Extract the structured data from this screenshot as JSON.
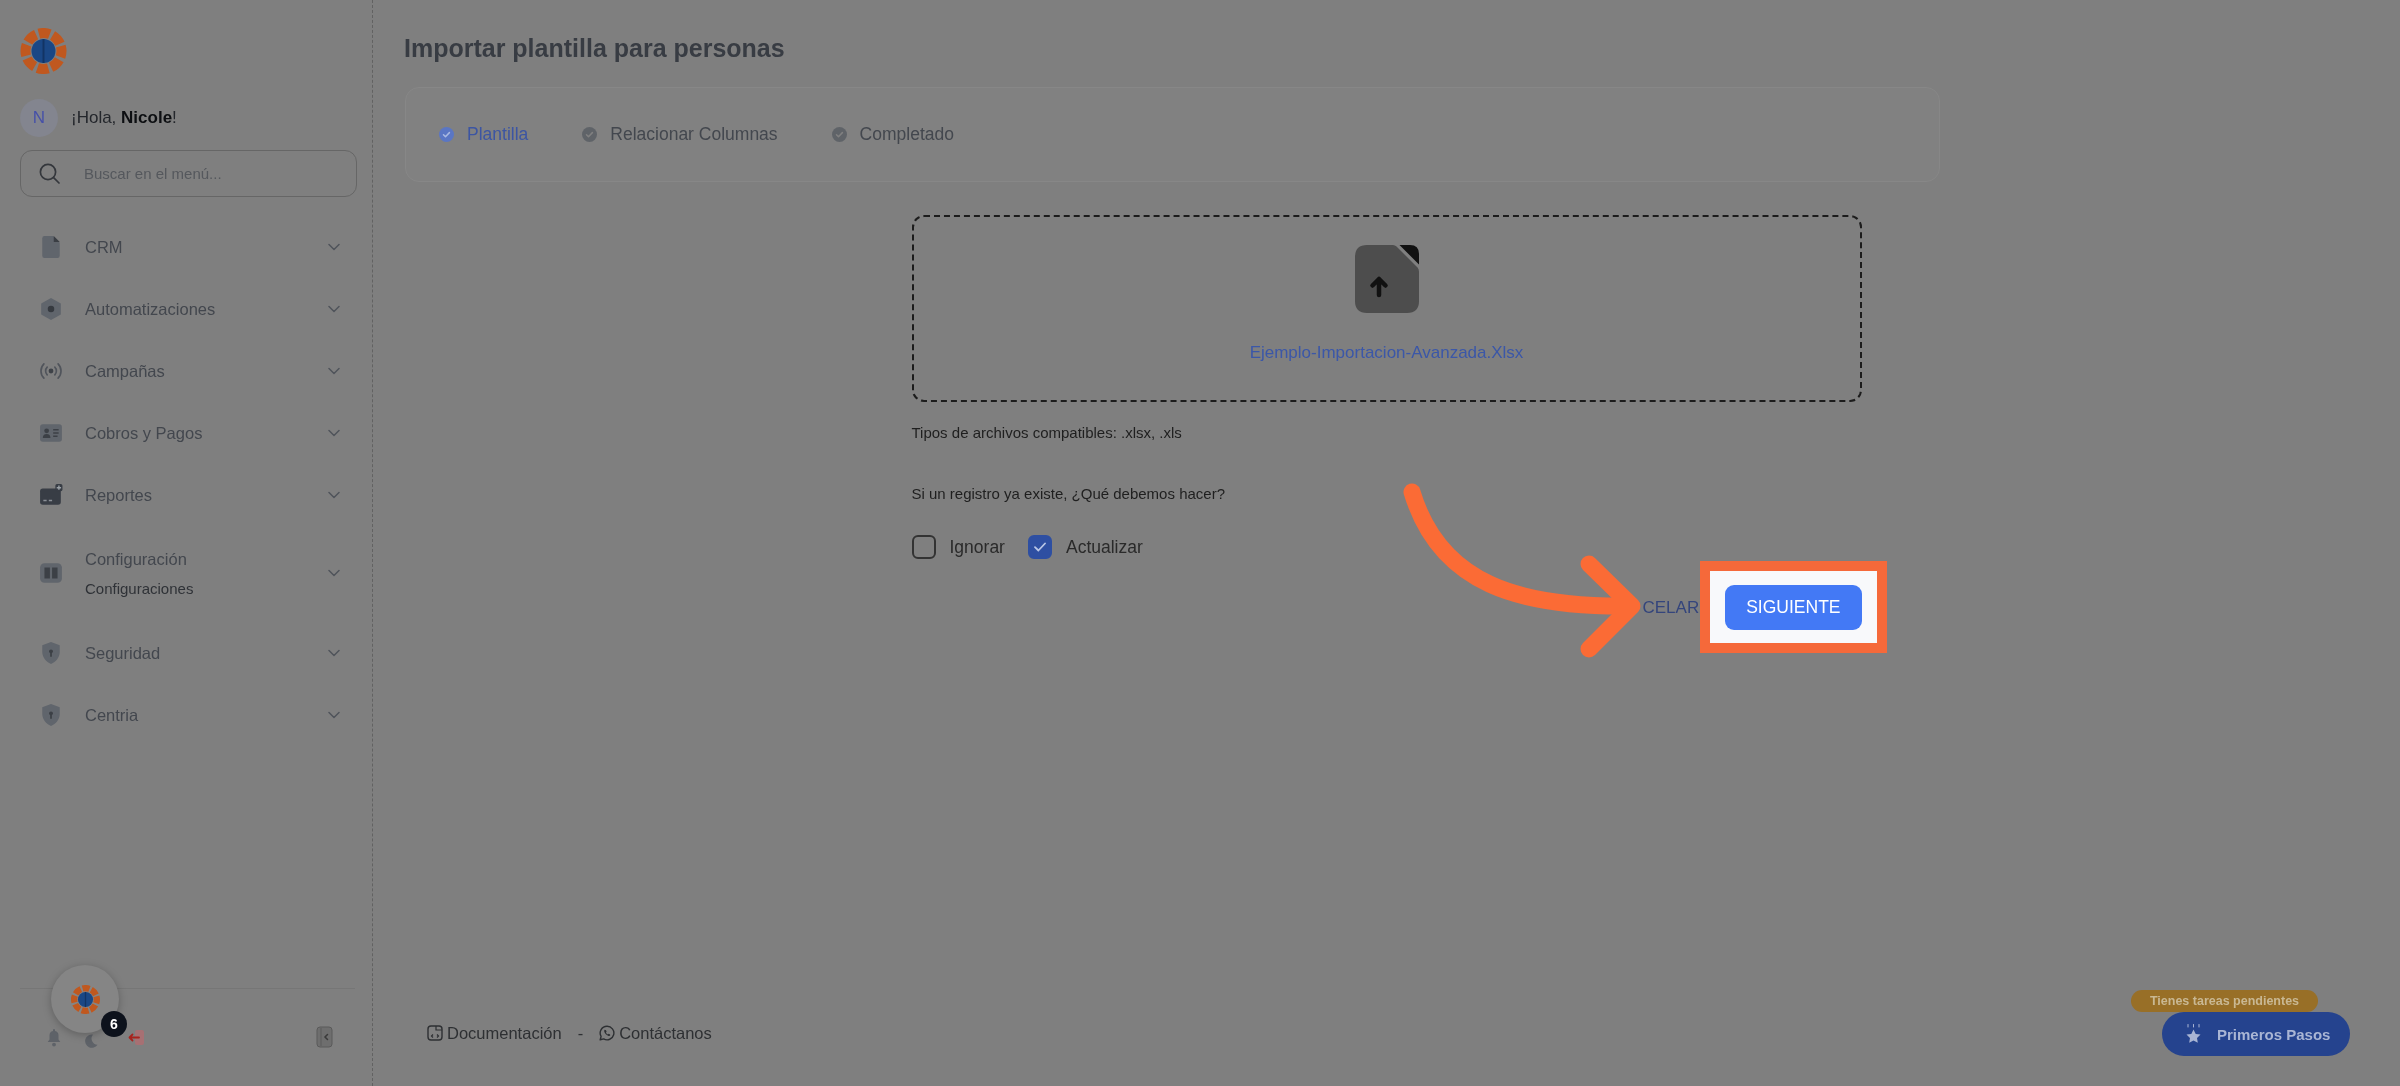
{
  "sidebar": {
    "greeting": {
      "initial": "N",
      "text": "¡Hola, **Nicole**!"
    },
    "search": {
      "placeholder": "Buscar en el menú..."
    },
    "items": [
      {
        "label": "CRM",
        "expanded": false
      },
      {
        "label": "Automatizaciones",
        "expanded": false
      },
      {
        "label": "Campañas",
        "expanded": false
      },
      {
        "label": "Cobros y Pagos",
        "expanded": false
      },
      {
        "label": "Reportes",
        "expanded": false
      },
      {
        "label": "Configuración",
        "sublabel": "Configuraciones",
        "expanded": false
      },
      {
        "label": "Seguridad",
        "expanded": false
      },
      {
        "label": "Centria",
        "expanded": false
      }
    ],
    "chat_badge": "6"
  },
  "page": {
    "title": "Importar plantilla para personas",
    "steps": [
      {
        "label": "Plantilla",
        "selected": true
      },
      {
        "label": "Relacionar Columnas",
        "selected": false
      },
      {
        "label": "Completado",
        "selected": false
      }
    ],
    "dropzone": {
      "file_name": "Ejemplo-Importacion-Avanzada.Xlsx"
    },
    "hint": "Tipos de archivos compatibles: .xlsx, .xls",
    "question": "Si un registro ya existe, ¿Qué debemos hacer?",
    "options": [
      {
        "label": "Ignorar",
        "checked": false
      },
      {
        "label": "Actualizar",
        "checked": true
      }
    ],
    "buttons": [
      {
        "label": "CELAR",
        "kind": "text",
        "highlighted": false
      },
      {
        "label": "SIGUIENTE",
        "kind": "primary",
        "highlighted": true
      }
    ]
  },
  "footer": {
    "links": [
      {
        "label": "Documentación"
      },
      {
        "label": "Contáctanos"
      }
    ],
    "separator": "-"
  },
  "help": {
    "notice": "Tienes tareas pendientes",
    "label": "Primeros Pasos"
  }
}
